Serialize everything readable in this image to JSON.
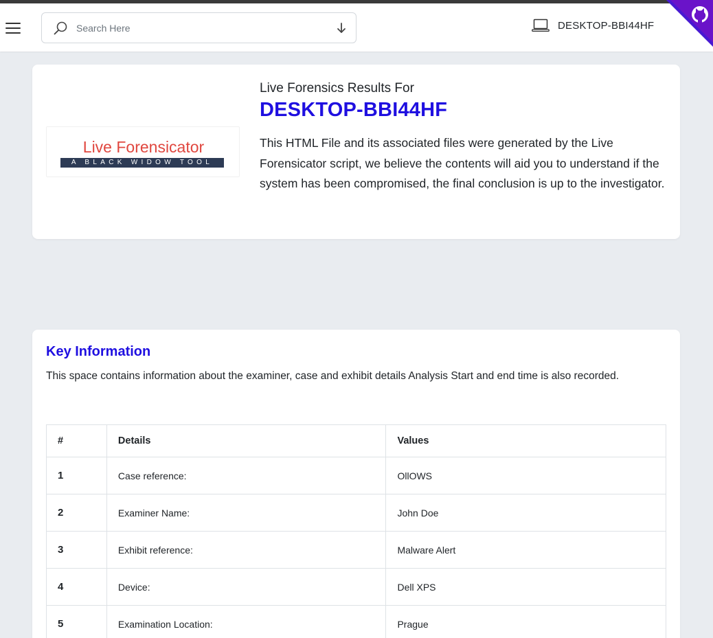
{
  "header": {
    "search_placeholder": "Search Here",
    "device_name": "DESKTOP-BBI44HF"
  },
  "colors": {
    "accent": "#1f0fe0",
    "logo_red": "#e0473f",
    "logo_bar": "#2d3b55",
    "github_corner": "#6a13c9"
  },
  "hero": {
    "logo_title": "Live Forensicator",
    "logo_tagline": "A BLACK WIDOW TOOL",
    "subtitle": "Live Forensics Results For",
    "hostname": "DESKTOP-BBI44HF",
    "description": "This HTML File and its associated files were generated by the Live Forensicator script, we believe the contents will aid you to understand if the system has been compromised, the final conclusion is up to the investigator."
  },
  "key_info": {
    "title": "Key Information",
    "description": "This space contains information about the examiner, case and exhibit details Analysis Start and end time is also recorded.",
    "columns": [
      "#",
      "Details",
      "Values"
    ],
    "rows": [
      {
        "num": "1",
        "detail": "Case reference:",
        "value": "OllOWS"
      },
      {
        "num": "2",
        "detail": "Examiner Name:",
        "value": "John Doe"
      },
      {
        "num": "3",
        "detail": "Exhibit reference:",
        "value": "Malware Alert"
      },
      {
        "num": "4",
        "detail": "Device:",
        "value": "Dell XPS"
      },
      {
        "num": "5",
        "detail": "Examination Location:",
        "value": "Prague"
      }
    ]
  },
  "icons": {
    "menu": "hamburger-menu-icon",
    "search": "magnifier-icon",
    "download": "arrow-down-icon",
    "device": "laptop-icon",
    "github": "github-octocat-icon"
  }
}
